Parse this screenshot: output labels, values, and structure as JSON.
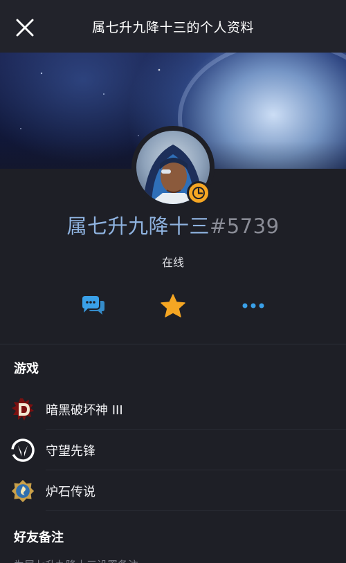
{
  "header": {
    "title": "属七升九降十三的个人资料"
  },
  "profile": {
    "name": "属七升九降十三",
    "tag": "#5739",
    "status": "在线"
  },
  "actions": {
    "chat_icon": "chat-icon",
    "favorite_icon": "star-icon",
    "more_icon": "more-icon"
  },
  "games_section": {
    "title": "游戏",
    "items": [
      {
        "label": "暗黑破坏神 III",
        "icon": "diablo-icon"
      },
      {
        "label": "守望先锋",
        "icon": "overwatch-icon"
      },
      {
        "label": "炉石传说",
        "icon": "hearthstone-icon"
      }
    ]
  },
  "notes_section": {
    "title": "好友备注",
    "placeholder": "为属七升九降十三设置备注"
  },
  "colors": {
    "background": "#1e1f26",
    "accent_blue": "#3aa0e8",
    "star_orange": "#f5a623",
    "name_blue": "#8fb3e0",
    "tag_gray": "#8a8c96"
  }
}
